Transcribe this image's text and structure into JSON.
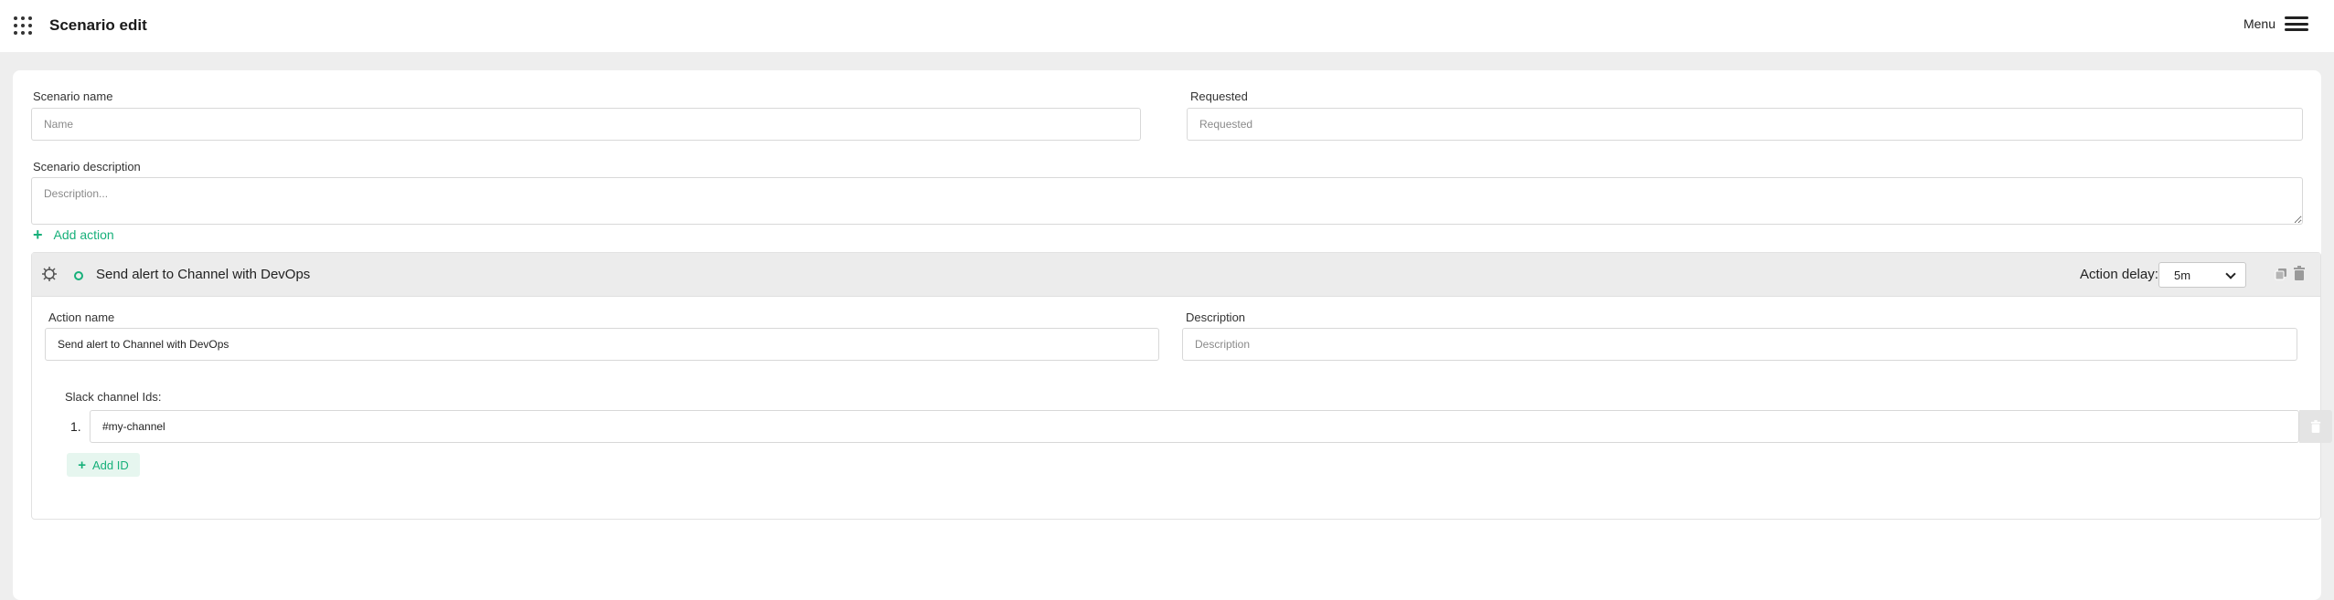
{
  "header": {
    "title": "Scenario edit",
    "menu_label": "Menu"
  },
  "form": {
    "scenario_name_label": "Scenario name",
    "scenario_name_placeholder": "Name",
    "requested_label": "Requested",
    "requested_placeholder": "Requested",
    "description_label": "Scenario description",
    "description_placeholder": "Description...",
    "add_action_label": "Add action"
  },
  "action": {
    "title": "Send alert to Channel with DevOps",
    "delay_label": "Action delay:",
    "delay_value": "5m",
    "name_label": "Action name",
    "name_value": "Send alert to Channel with DevOps",
    "description_label": "Description",
    "description_placeholder": "Description",
    "slack_label": "Slack channel Ids:",
    "channels": [
      {
        "index": "1.",
        "value": "#my-channel"
      }
    ],
    "add_id_label": "Add ID"
  },
  "colors": {
    "accent": "#17b07a",
    "header_bg": "#ffffff",
    "page_bg": "#eeeeee"
  },
  "icons": [
    "apps-grid-icon",
    "hamburger-menu-icon",
    "plus-icon",
    "drag-handle-icon",
    "status-circle-icon",
    "chevron-down-icon",
    "copy-icon",
    "trash-icon"
  ]
}
